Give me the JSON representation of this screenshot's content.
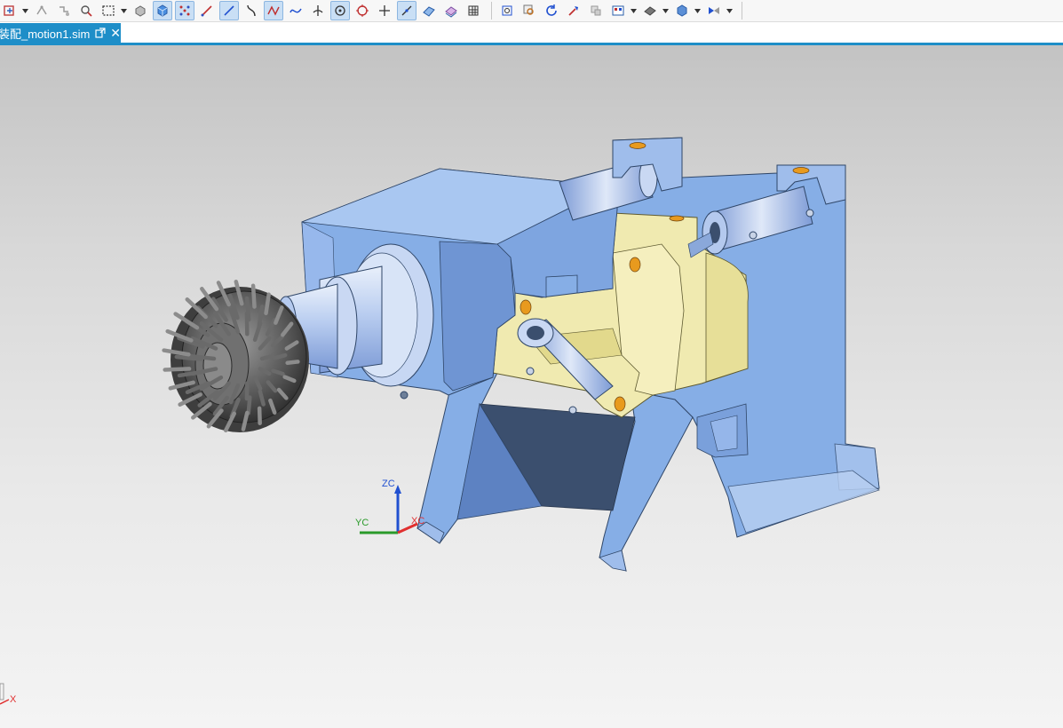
{
  "document_tab": {
    "label": "装配_motion1.sim",
    "close_glyph": "✕"
  },
  "toolbar": {
    "groups": [
      {
        "icons": [
          "snap-icon",
          "drop",
          "selection-lasso-icon",
          "selection-chain-icon",
          "feature-select-icon",
          "rectangle-select-icon",
          "drop",
          "solid-body-icon",
          "cube-filter-icon",
          "point-cloud-icon",
          "line-tool-icon",
          "edge-tool-icon",
          "curve-tool-icon",
          "spline-icon",
          "freeform-curve-icon",
          "intersection-icon",
          "circle-center-icon",
          "quadrant-icon",
          "cross-point-icon",
          "tangent-icon",
          "surface-icon",
          "face-icon",
          "grid-icon"
        ]
      },
      {
        "icons": [
          "fit-view-icon",
          "zoom-region-icon",
          "rotate-view-icon",
          "pan-icon",
          "orient-icon",
          "layout-icon",
          "drop",
          "render-style-icon",
          "drop",
          "view-cube-icon",
          "drop",
          "show-hide-icon",
          "drop"
        ]
      }
    ]
  },
  "viewport": {
    "background_top": "#c3c3c3",
    "background_bottom": "#f4f4f4",
    "triad": {
      "z_label": "ZC",
      "y_label": "YC",
      "x_label": "XC"
    },
    "absolute_triad": {
      "x_label": "X"
    },
    "colors": {
      "blue_body": "#86aee6",
      "blue_shadow": "#5d82c2",
      "blue_dark": "#3b4f6e",
      "yellow_part": "#f0eab0",
      "orange_bolt": "#e89a1e",
      "grey_cutter": "#5a5a5a",
      "axis_x": "#e03030",
      "axis_y": "#2a9a2a",
      "axis_z": "#2050d0"
    }
  }
}
